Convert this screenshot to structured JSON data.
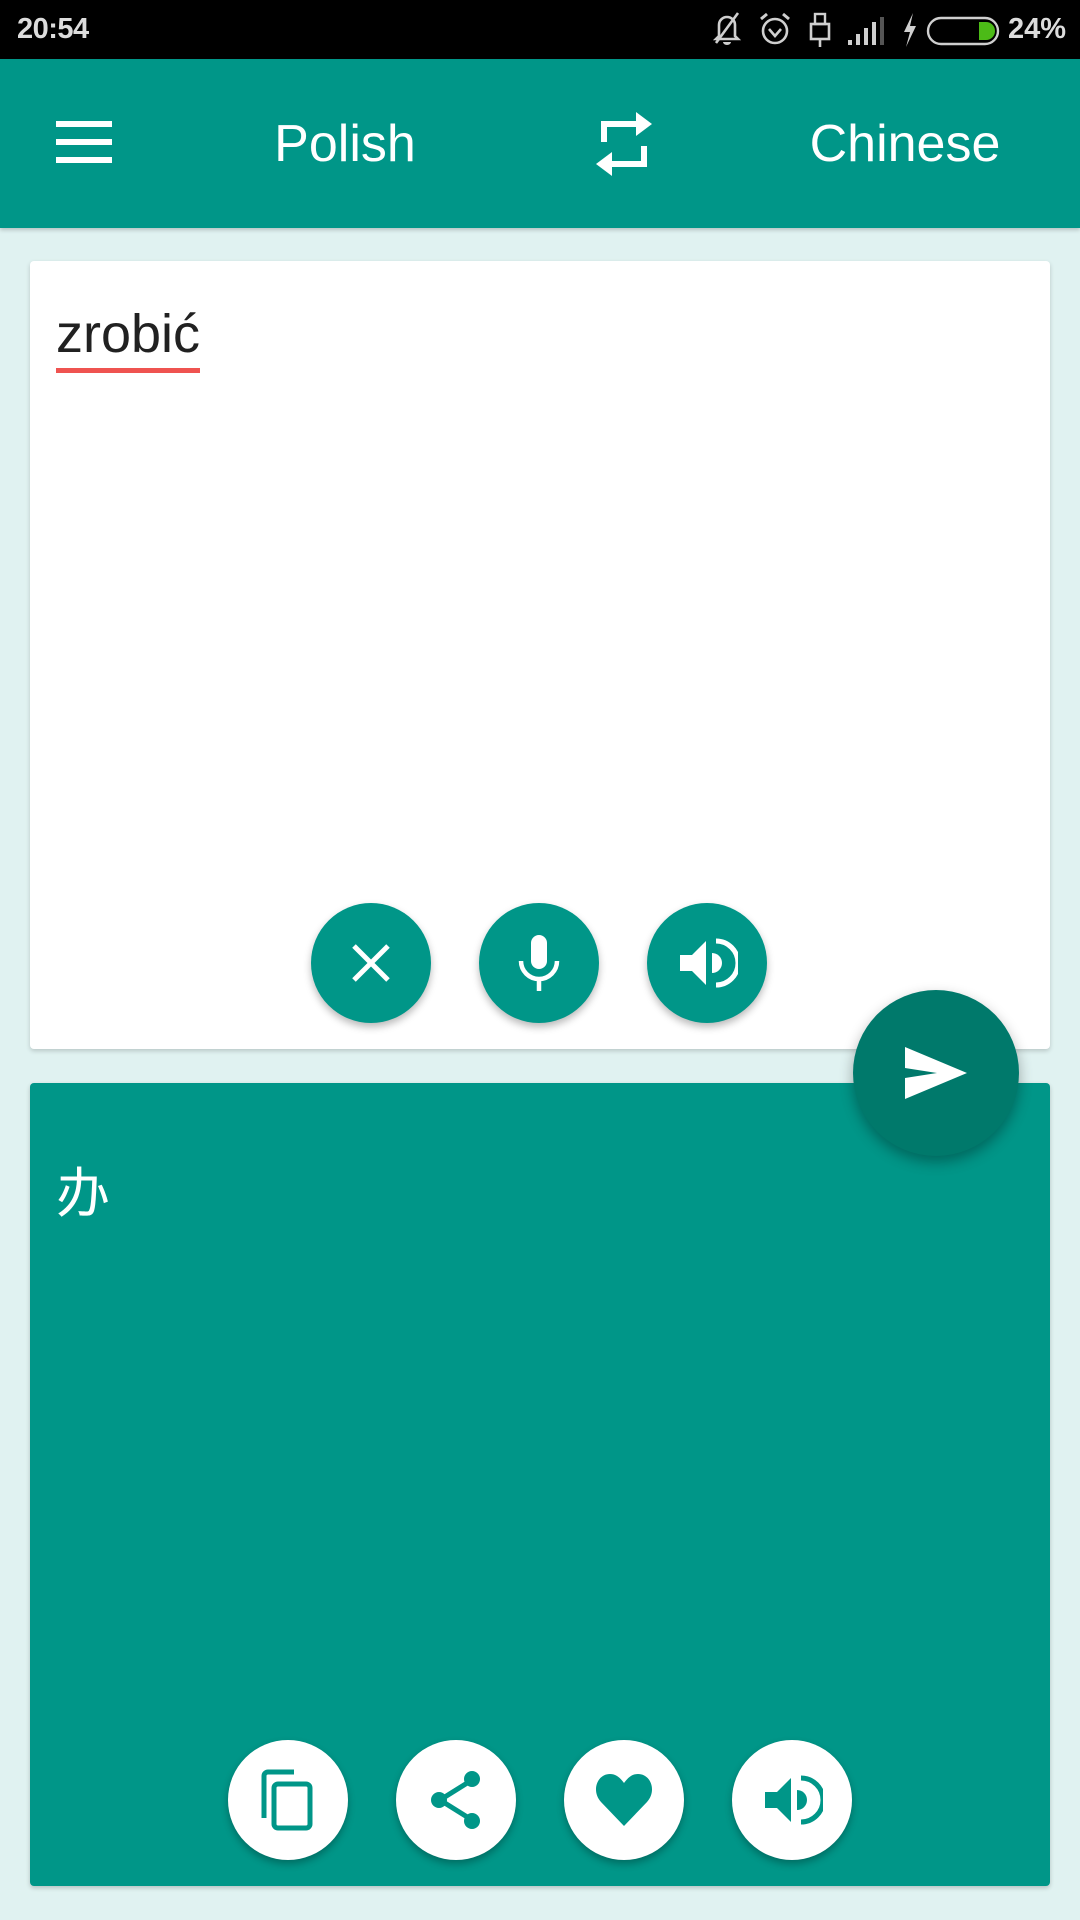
{
  "status_bar": {
    "time": "20:54",
    "battery_percent": "24%",
    "battery_level": 0.24,
    "icons": [
      "notifications-off-icon",
      "alarm-icon",
      "usb-icon",
      "signal-icon",
      "charging-icon",
      "battery-icon"
    ]
  },
  "app_bar": {
    "menu_icon": "menu-icon",
    "source_language": "Polish",
    "swap_icon": "swap-icon",
    "target_language": "Chinese"
  },
  "input_card": {
    "text": "zrobić",
    "actions": [
      {
        "name": "clear",
        "icon": "close-icon"
      },
      {
        "name": "voice-input",
        "icon": "microphone-icon"
      },
      {
        "name": "speak-source",
        "icon": "volume-icon"
      }
    ]
  },
  "send_button": {
    "icon": "send-icon"
  },
  "output_card": {
    "text": "办",
    "actions": [
      {
        "name": "copy",
        "icon": "copy-icon"
      },
      {
        "name": "share",
        "icon": "share-icon"
      },
      {
        "name": "favorite",
        "icon": "heart-icon"
      },
      {
        "name": "speak-translation",
        "icon": "volume-icon"
      }
    ]
  },
  "colors": {
    "primary": "#009688",
    "primary_dark": "#00796b",
    "background": "#e0f2f1",
    "spellcheck_underline": "#ef5350",
    "battery_fill": "#4cbb17"
  }
}
